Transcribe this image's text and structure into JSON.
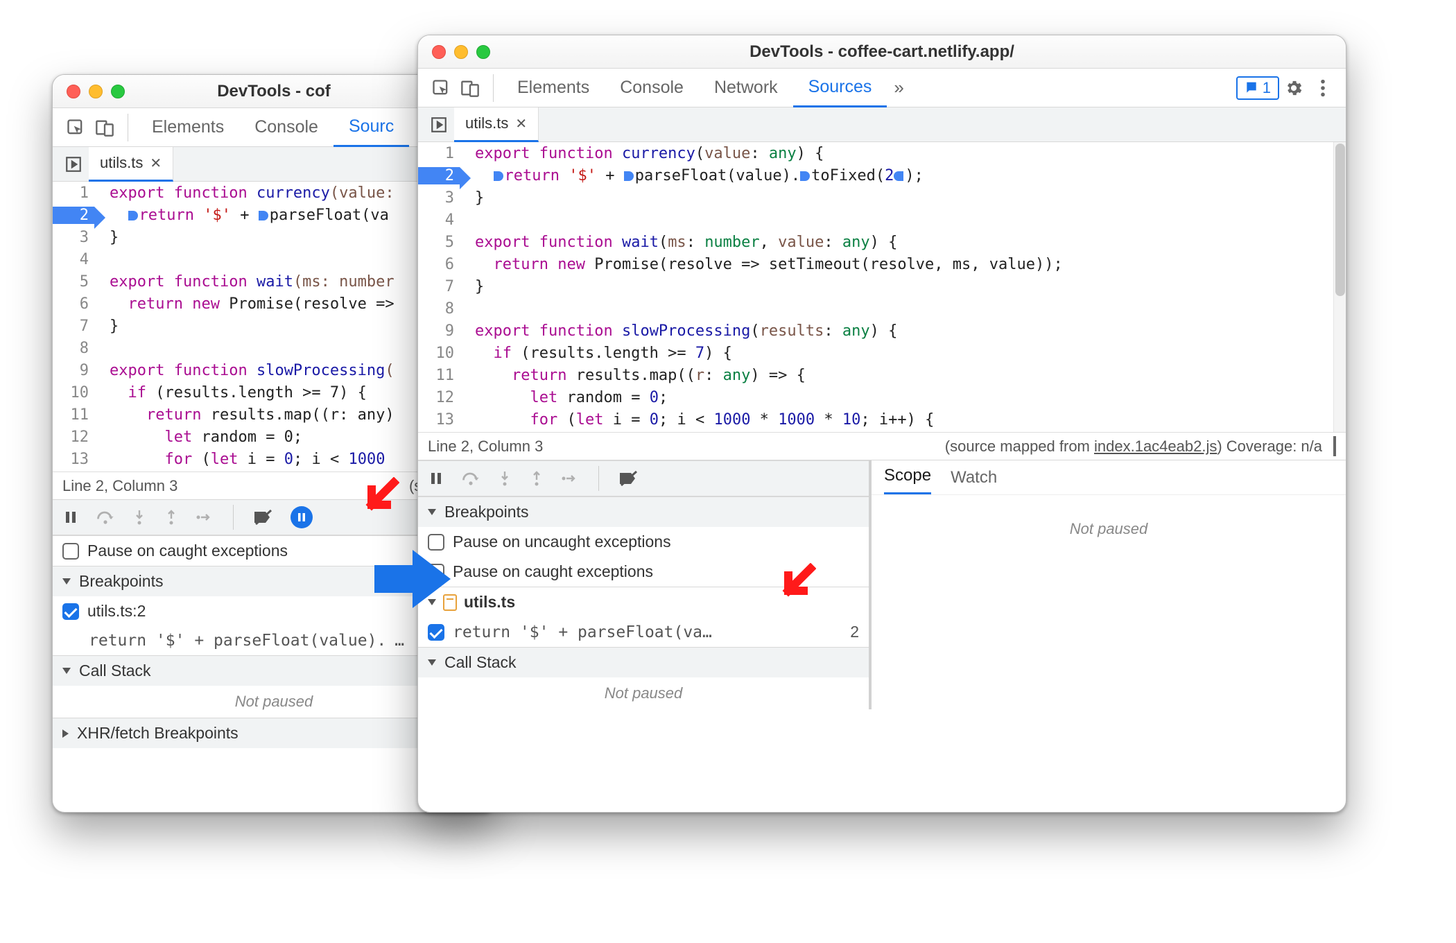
{
  "left": {
    "title": "DevTools - cof",
    "tabs": {
      "elements": "Elements",
      "console": "Console",
      "sources": "Sourc"
    },
    "file_tab": "utils.ts",
    "code": {
      "1": {
        "pre": "export",
        "kw2": "function",
        "fn": "currency",
        "rest": "(value:"
      },
      "2": {
        "ret": "return",
        "str": "'$'",
        "plus": " + ",
        "pf": "parseFloat(va"
      },
      "3": "}",
      "5": {
        "pre": "export",
        "kw2": "function",
        "fn": "wait",
        "rest": "(ms: number"
      },
      "6": {
        "ret": "return",
        "new": "new",
        "prom": "Promise(resolve =>"
      },
      "7": "}",
      "9": {
        "pre": "export",
        "kw2": "function",
        "fn": "slowProcessing",
        "rest": "("
      },
      "10": {
        "if": "if",
        "rest": " (results.length >= 7) {"
      },
      "11": {
        "ret": "return",
        "rest": " results.map((r: any)"
      },
      "12": {
        "let": "let",
        "rest": " random = 0;"
      }
    },
    "status": {
      "pos": "Line 2, Column 3",
      "mapped": "(source ma"
    },
    "pause_caught": "Pause on caught exceptions",
    "breakpoints_header": "Breakpoints",
    "bp_file": "utils.ts:2",
    "bp_code": "return '$' + parseFloat(value).",
    "callstack_header": "Call Stack",
    "not_paused": "Not paused",
    "xhr_header": "XHR/fetch Breakpoints"
  },
  "right": {
    "title": "DevTools - coffee-cart.netlify.app/",
    "tabs": {
      "elements": "Elements",
      "console": "Console",
      "network": "Network",
      "sources": "Sources"
    },
    "issues_count": "1",
    "file_tab": "utils.ts",
    "code": {
      "1": "export function currency(value: any) {",
      "2": "return '$' + parseFloat(value).toFixed(2);",
      "3": "}",
      "5": "export function wait(ms: number, value: any) {",
      "6": "return new Promise(resolve => setTimeout(resolve, ms, value));",
      "7": "}",
      "9": "export function slowProcessing(results: any) {",
      "10": "if (results.length >= 7) {",
      "11": "return results.map((r: any) => {",
      "12": "let random = 0;"
    },
    "status": {
      "pos": "Line 2, Column 3",
      "mapped_pre": "(source mapped from ",
      "mapped_file": "index.1ac4eab2.js",
      "mapped_suf": ") Coverage: n/a"
    },
    "breakpoints_header": "Breakpoints",
    "pause_uncaught": "Pause on uncaught exceptions",
    "pause_caught": "Pause on caught exceptions",
    "bp_group": "utils.ts",
    "bp_code": "return '$' + parseFloat(va…",
    "bp_line": "2",
    "callstack_header": "Call Stack",
    "not_paused": "Not paused",
    "scope_tab": "Scope",
    "watch_tab": "Watch",
    "scope_not_paused": "Not paused"
  }
}
